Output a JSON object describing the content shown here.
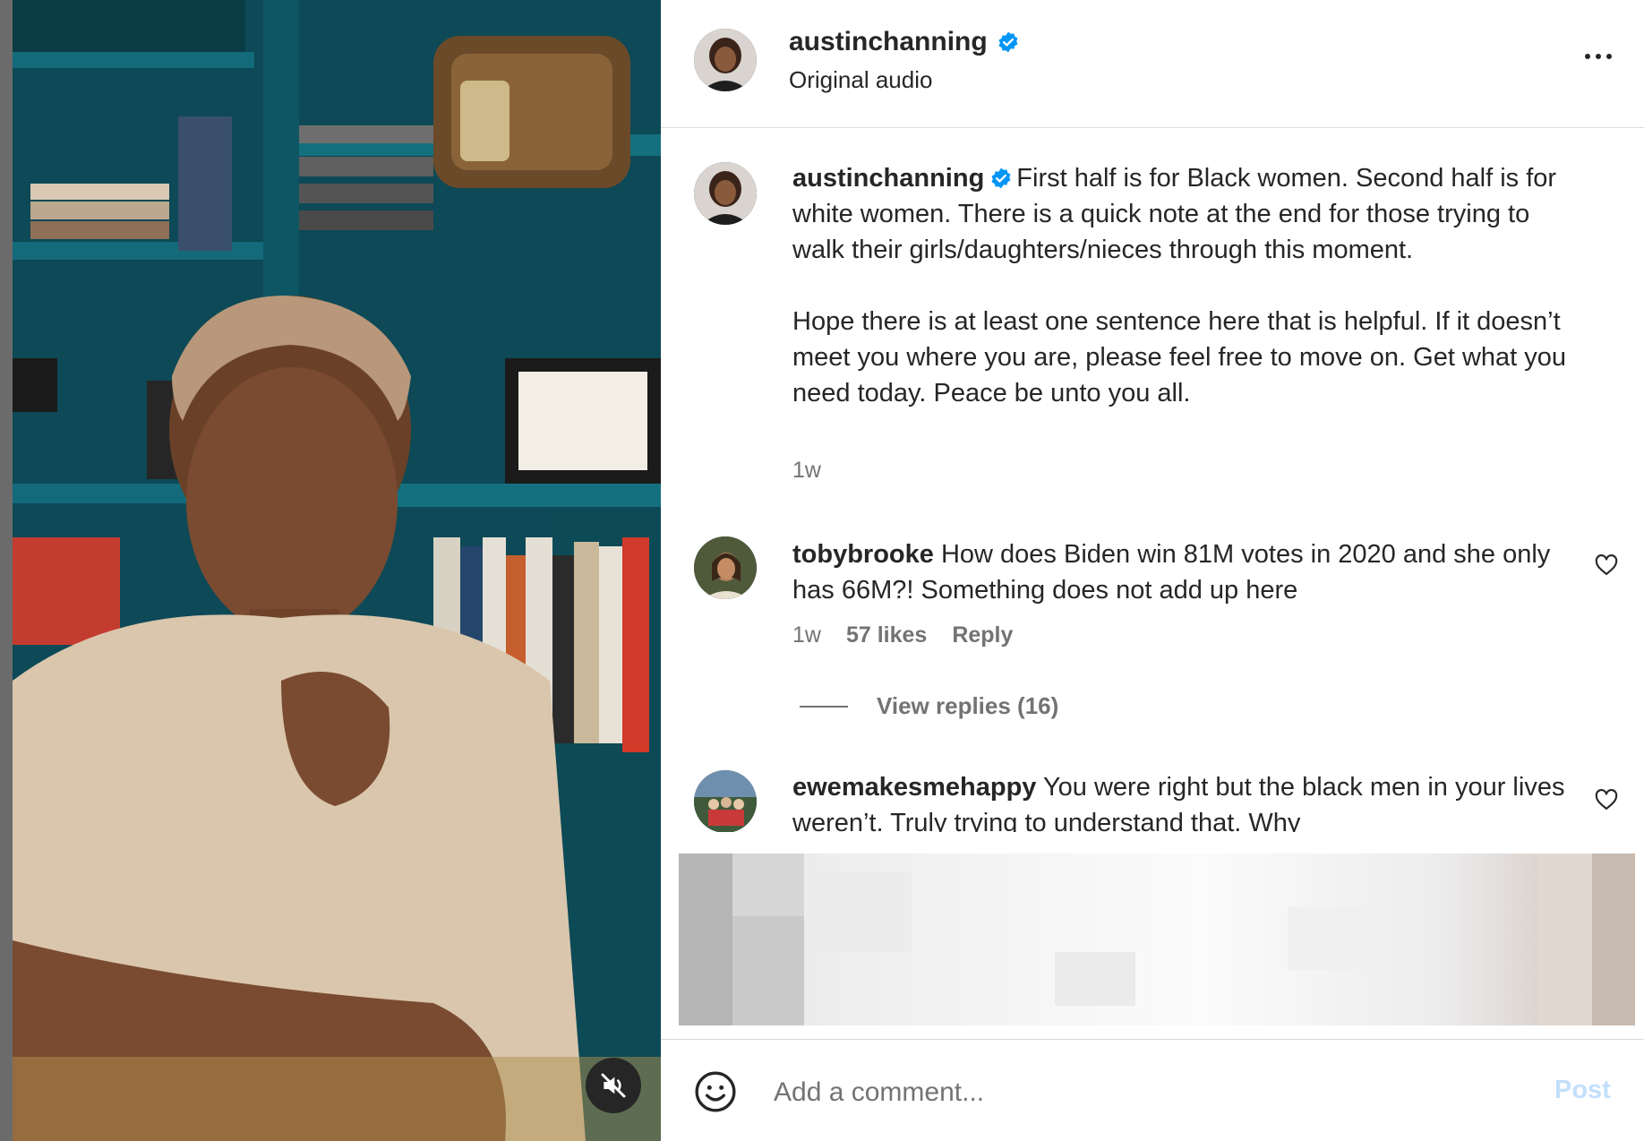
{
  "post": {
    "username": "austinchanning",
    "subtitle": "Original audio",
    "caption_line1": "First half is for Black women. Second half is for white women. There is a quick note at the end for those trying to walk their girls/daughters/nieces through this moment.",
    "caption_line2": "Hope there is at least one sentence here that is helpful. If it doesn’t meet you where you are, please feel free to move on. Get what you need today. Peace be unto you all.",
    "caption_time": "1w"
  },
  "comments": [
    {
      "username": "tobybrooke",
      "text": "How does Biden win 81M votes in 2020 and she only has 66M?! Something does not add up here",
      "time": "1w",
      "likes": "57 likes",
      "reply_label": "Reply",
      "view_replies": "View replies (16)"
    },
    {
      "username": "ewemakesmehappy",
      "text": "You were right but the black men in your lives weren’t. Truly trying to understand that. Why"
    }
  ],
  "composer": {
    "placeholder": "Add a comment...",
    "post_label": "Post"
  },
  "icons": {
    "verified": "verified-badge-icon",
    "more": "more-options-icon",
    "heart": "heart-icon",
    "emoji": "emoji-icon",
    "mute": "muted-speaker-icon"
  },
  "colors": {
    "verified_blue": "#0095f6",
    "post_button_disabled": "#c3dffb",
    "secondary_text": "#737373"
  }
}
